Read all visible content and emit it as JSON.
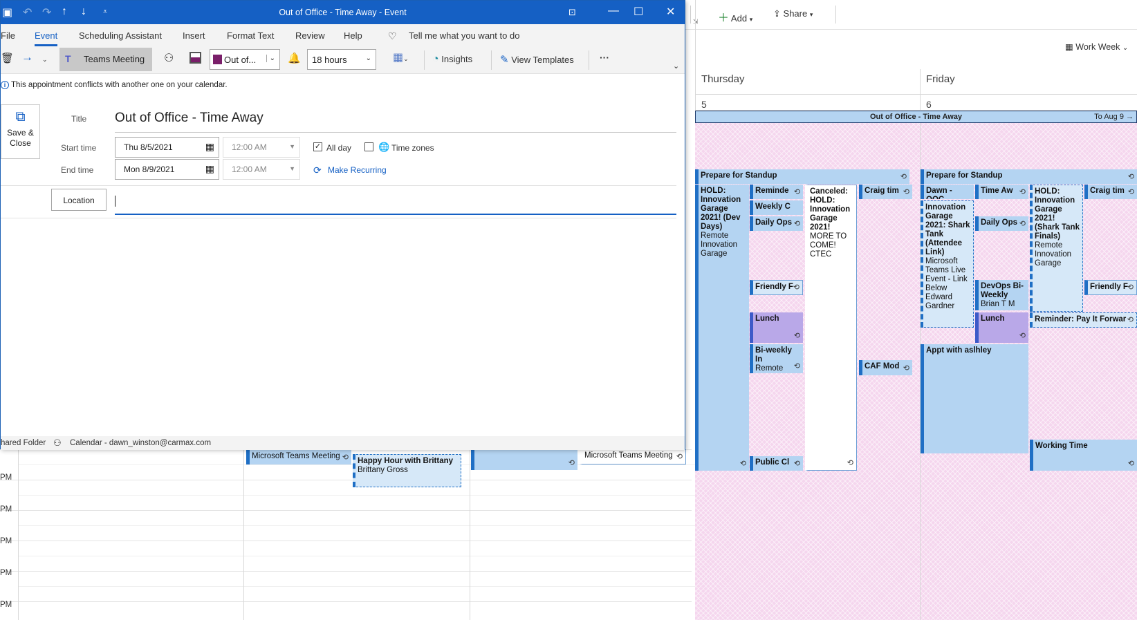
{
  "dialog": {
    "window_title": "Out of Office - Time Away  -  Event",
    "menu": [
      "File",
      "Event",
      "Scheduling Assistant",
      "Insert",
      "Format Text",
      "Review",
      "Help"
    ],
    "tell_me": "Tell me what you want to do",
    "ribbon": {
      "teams_meeting": "Teams Meeting",
      "show_as": "Out of...",
      "reminder": "18 hours",
      "insights": "Insights",
      "view_templates": "View Templates",
      "more": "···"
    },
    "conflict_notice": "This appointment conflicts with another one on your calendar.",
    "save_close": "Save &\nClose",
    "title_label": "Title",
    "title_value": "Out of Office - Time Away",
    "start_label": "Start time",
    "start_date": "Thu 8/5/2021",
    "start_time": "12:00 AM",
    "end_label": "End time",
    "end_date": "Mon 8/9/2021",
    "end_time": "12:00 AM",
    "all_day": "All day",
    "all_day_checked": true,
    "time_zones": "Time zones",
    "make_recurring": "Make Recurring",
    "location_button": "Location",
    "location_value": "",
    "status_folder": "hared Folder",
    "status_calendar": "Calendar - dawn_winston@carmax.com"
  },
  "calendar": {
    "toolbar": {
      "add": "Add",
      "share": "Share",
      "view": "Work Week"
    },
    "days": [
      {
        "name": "Thursday",
        "num": "5"
      },
      {
        "name": "Friday",
        "num": "6"
      }
    ],
    "all_day_event": {
      "title": "Out of Office - Time Away",
      "to": "To Aug 9 →"
    },
    "pm_labels": [
      "PM",
      "PM",
      "PM",
      "PM",
      "PM"
    ],
    "lower_events": [
      {
        "title": "Microsoft Teams Meeting"
      },
      {
        "title": "Happy Hour with Brittany",
        "sub": "Brittany Gross"
      },
      {
        "title": "Microsoft Teams Meeting"
      }
    ],
    "thursday_events": [
      {
        "title": "Prepare for Standup"
      },
      {
        "title": "HOLD: Innovation Garage 2021! (Dev Days)",
        "sub": "Remote Innovation Garage"
      },
      {
        "title": "Reminde"
      },
      {
        "title": "Weekly C"
      },
      {
        "title": "Daily Ops"
      },
      {
        "title": "Canceled: HOLD: Innovation Garage 2021!",
        "sub": "MORE TO COME! CTEC"
      },
      {
        "title": "Craig tim"
      },
      {
        "title": "Friendly F"
      },
      {
        "title": "Lunch"
      },
      {
        "title": "Bi-weekly In",
        "sub": "Remote Technolo"
      },
      {
        "title": "CAF Mod"
      },
      {
        "title": "Public Cl"
      }
    ],
    "friday_events": [
      {
        "title": "Prepare for Standup"
      },
      {
        "title": "Dawn - OOC"
      },
      {
        "title": "Time Aw"
      },
      {
        "title": "HOLD: Innovation Garage 2021! (Shark Tank Finals)",
        "sub": "Remote Innovation Garage"
      },
      {
        "title": "Craig tim"
      },
      {
        "title": "Innovation Garage 2021: Shark Tank (Attendee Link)",
        "sub": "Microsoft Teams Live Event - Link Below Edward Gardner"
      },
      {
        "title": "Daily Ops"
      },
      {
        "title": "DevOps Bi-Weekly",
        "sub": "Brian T M"
      },
      {
        "title": "Friendly F"
      },
      {
        "title": "Lunch"
      },
      {
        "title": "Reminder:  Pay It Forwar"
      },
      {
        "title": "Appt with aslhley"
      },
      {
        "title": "Working Time"
      }
    ]
  },
  "colors": {
    "accent": "#1560c4",
    "event_blue": "#b4d4f2",
    "ooo_pink": "#f5d6ee",
    "lunch_purple": "#b9a8e8"
  }
}
